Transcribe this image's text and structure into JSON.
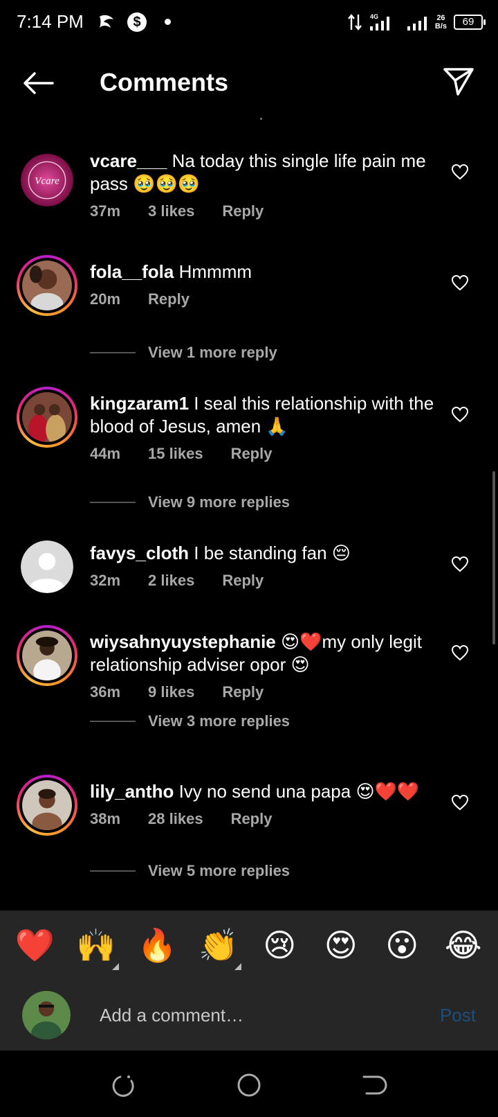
{
  "status_bar": {
    "time": "7:14 PM",
    "network": "4G",
    "speed_value": "26",
    "speed_unit": "B/s",
    "battery": "69"
  },
  "header": {
    "title": "Comments",
    "back_icon": "arrow-left-icon",
    "share_icon": "paper-plane-icon"
  },
  "comments": [
    {
      "username": "vcare___",
      "text": " Na today this single life pain me pass 🥹🥹🥹",
      "time": "37m",
      "likes": "3 likes",
      "reply": "Reply"
    },
    {
      "username": "fola__fola",
      "text": " Hmmmm",
      "time": "20m",
      "likes": "",
      "reply": "Reply",
      "view_replies": "View 1 more reply"
    },
    {
      "username": "kingzaram1",
      "text": " I seal this relationship with the blood of Jesus, amen 🙏",
      "time": "44m",
      "likes": "15 likes",
      "reply": "Reply",
      "view_replies": "View 9 more replies"
    },
    {
      "username": "favys_cloth",
      "text": " I be standing fan 😔",
      "time": "32m",
      "likes": "2 likes",
      "reply": "Reply"
    },
    {
      "username": "wiysahnyuystephanie",
      "text": " 😍❤️my only legit relationship adviser opor 😍",
      "time": "36m",
      "likes": "9 likes",
      "reply": "Reply",
      "view_replies": "View 3 more replies"
    },
    {
      "username": "lily_antho",
      "text": " Ivy no send una papa 😍❤️❤️",
      "time": "38m",
      "likes": "28 likes",
      "reply": "Reply",
      "view_replies": "View 5 more replies"
    }
  ],
  "emoji_bar": [
    "❤️",
    "🙌",
    "🔥",
    "👏",
    "😢",
    "😍",
    "😮",
    "😂"
  ],
  "composer": {
    "placeholder": "Add a comment…",
    "post_label": "Post"
  },
  "colors": {
    "background": "#000000",
    "panel": "#262626",
    "meta_text": "#a8a8a8",
    "post_disabled": "#1c4f7a"
  }
}
